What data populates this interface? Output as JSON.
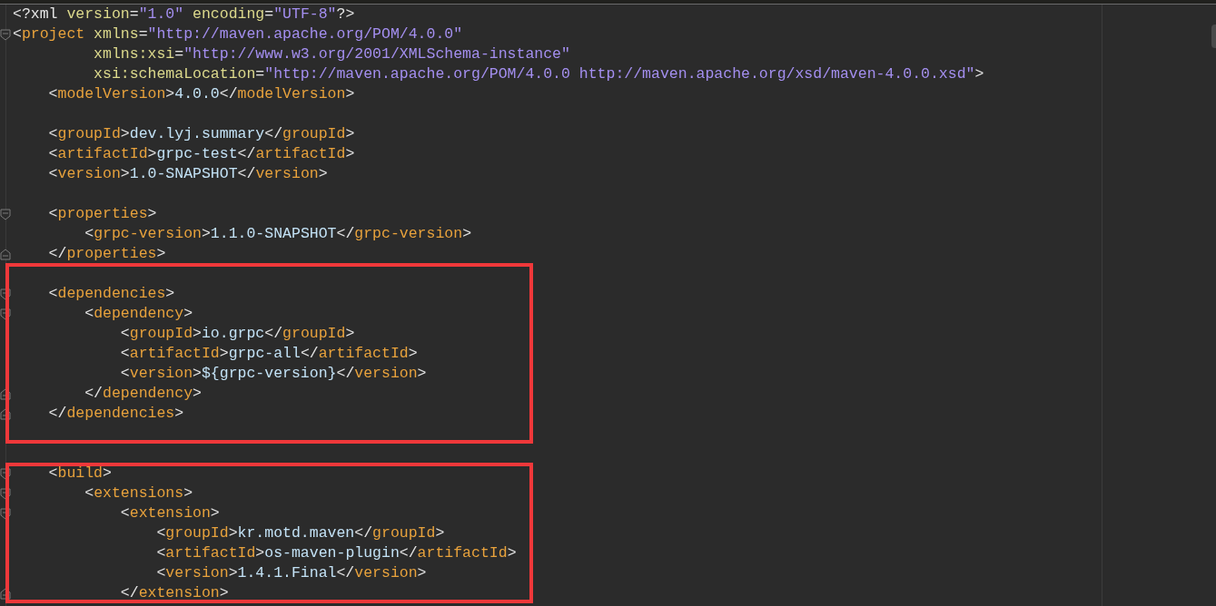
{
  "editor": {
    "blocks": [
      {
        "highlighted": false,
        "lines": [
          {
            "kind": "code",
            "segments": [
              {
                "kind": "punct",
                "text": "<?xml"
              },
              {
                "kind": "attr",
                "text": " version"
              },
              {
                "kind": "punct",
                "text": "="
              },
              {
                "kind": "value",
                "text": "\"1.0\""
              },
              {
                "kind": "attr",
                "text": " encoding"
              },
              {
                "kind": "punct",
                "text": "="
              },
              {
                "kind": "value",
                "text": "\"UTF-8\""
              },
              {
                "kind": "punct",
                "text": "?>"
              }
            ]
          },
          {
            "kind": "fold-start",
            "segments": [
              {
                "kind": "punct",
                "text": "<"
              },
              {
                "kind": "tag",
                "text": "project"
              },
              {
                "kind": "attr",
                "text": " xmlns"
              },
              {
                "kind": "punct",
                "text": "="
              },
              {
                "kind": "value",
                "text": "\"http://maven.apache.org/POM/4.0.0\""
              }
            ]
          },
          {
            "kind": "code",
            "segments": [
              {
                "kind": "attr",
                "text": "         xmlns:xsi"
              },
              {
                "kind": "punct",
                "text": "="
              },
              {
                "kind": "value",
                "text": "\"http://www.w3.org/2001/XMLSchema-instance\""
              }
            ]
          },
          {
            "kind": "code",
            "segments": [
              {
                "kind": "attr",
                "text": "         xsi:schemaLocation"
              },
              {
                "kind": "punct",
                "text": "="
              },
              {
                "kind": "value",
                "text": "\"http://maven.apache.org/POM/4.0.0 http://maven.apache.org/xsd/maven-4.0.0.xsd\""
              },
              {
                "kind": "punct",
                "text": ">"
              }
            ]
          },
          {
            "kind": "code",
            "segments": [
              {
                "kind": "punct",
                "text": "    <"
              },
              {
                "kind": "tag",
                "text": "modelVersion"
              },
              {
                "kind": "punct",
                "text": ">"
              },
              {
                "kind": "text",
                "text": "4.0.0"
              },
              {
                "kind": "punct",
                "text": "</"
              },
              {
                "kind": "tag",
                "text": "modelVersion"
              },
              {
                "kind": "punct",
                "text": ">"
              }
            ]
          },
          {
            "kind": "blank"
          },
          {
            "kind": "code",
            "segments": [
              {
                "kind": "punct",
                "text": "    <"
              },
              {
                "kind": "tag",
                "text": "groupId"
              },
              {
                "kind": "punct",
                "text": ">"
              },
              {
                "kind": "text",
                "text": "dev.lyj.summary"
              },
              {
                "kind": "punct",
                "text": "</"
              },
              {
                "kind": "tag",
                "text": "groupId"
              },
              {
                "kind": "punct",
                "text": ">"
              }
            ]
          },
          {
            "kind": "code",
            "segments": [
              {
                "kind": "punct",
                "text": "    <"
              },
              {
                "kind": "tag",
                "text": "artifactId"
              },
              {
                "kind": "punct",
                "text": ">"
              },
              {
                "kind": "text",
                "text": "grpc-test"
              },
              {
                "kind": "punct",
                "text": "</"
              },
              {
                "kind": "tag",
                "text": "artifactId"
              },
              {
                "kind": "punct",
                "text": ">"
              }
            ]
          },
          {
            "kind": "code",
            "segments": [
              {
                "kind": "punct",
                "text": "    <"
              },
              {
                "kind": "tag",
                "text": "version"
              },
              {
                "kind": "punct",
                "text": ">"
              },
              {
                "kind": "text",
                "text": "1.0-SNAPSHOT"
              },
              {
                "kind": "punct",
                "text": "</"
              },
              {
                "kind": "tag",
                "text": "version"
              },
              {
                "kind": "punct",
                "text": ">"
              }
            ]
          },
          {
            "kind": "blank"
          },
          {
            "kind": "fold-start",
            "segments": [
              {
                "kind": "punct",
                "text": "    <"
              },
              {
                "kind": "tag",
                "text": "properties"
              },
              {
                "kind": "punct",
                "text": ">"
              }
            ]
          },
          {
            "kind": "code",
            "segments": [
              {
                "kind": "punct",
                "text": "        <"
              },
              {
                "kind": "tag",
                "text": "grpc-version"
              },
              {
                "kind": "punct",
                "text": ">"
              },
              {
                "kind": "text",
                "text": "1.1.0-SNAPSHOT"
              },
              {
                "kind": "punct",
                "text": "</"
              },
              {
                "kind": "tag",
                "text": "grpc-version"
              },
              {
                "kind": "punct",
                "text": ">"
              }
            ]
          },
          {
            "kind": "fold-end",
            "segments": [
              {
                "kind": "punct",
                "text": "    </"
              },
              {
                "kind": "tag",
                "text": "properties"
              },
              {
                "kind": "punct",
                "text": ">"
              }
            ]
          }
        ]
      },
      {
        "highlighted": true,
        "lines": [
          {
            "kind": "blank"
          },
          {
            "kind": "fold-start",
            "segments": [
              {
                "kind": "punct",
                "text": "    <"
              },
              {
                "kind": "tag",
                "text": "dependencies"
              },
              {
                "kind": "punct",
                "text": ">"
              }
            ]
          },
          {
            "kind": "fold-start",
            "segments": [
              {
                "kind": "punct",
                "text": "        <"
              },
              {
                "kind": "tag",
                "text": "dependency"
              },
              {
                "kind": "punct",
                "text": ">"
              }
            ]
          },
          {
            "kind": "code",
            "segments": [
              {
                "kind": "punct",
                "text": "            <"
              },
              {
                "kind": "tag",
                "text": "groupId"
              },
              {
                "kind": "punct",
                "text": ">"
              },
              {
                "kind": "text",
                "text": "io.grpc"
              },
              {
                "kind": "punct",
                "text": "</"
              },
              {
                "kind": "tag",
                "text": "groupId"
              },
              {
                "kind": "punct",
                "text": ">"
              }
            ]
          },
          {
            "kind": "code",
            "segments": [
              {
                "kind": "punct",
                "text": "            <"
              },
              {
                "kind": "tag",
                "text": "artifactId"
              },
              {
                "kind": "punct",
                "text": ">"
              },
              {
                "kind": "text",
                "text": "grpc-all"
              },
              {
                "kind": "punct",
                "text": "</"
              },
              {
                "kind": "tag",
                "text": "artifactId"
              },
              {
                "kind": "punct",
                "text": ">"
              }
            ]
          },
          {
            "kind": "code",
            "segments": [
              {
                "kind": "punct",
                "text": "            <"
              },
              {
                "kind": "tag",
                "text": "version"
              },
              {
                "kind": "punct",
                "text": ">"
              },
              {
                "kind": "text",
                "text": "${grpc-version}"
              },
              {
                "kind": "punct",
                "text": "</"
              },
              {
                "kind": "tag",
                "text": "version"
              },
              {
                "kind": "punct",
                "text": ">"
              }
            ]
          },
          {
            "kind": "fold-end",
            "segments": [
              {
                "kind": "punct",
                "text": "        </"
              },
              {
                "kind": "tag",
                "text": "dependency"
              },
              {
                "kind": "punct",
                "text": ">"
              }
            ]
          },
          {
            "kind": "fold-end",
            "segments": [
              {
                "kind": "punct",
                "text": "    </"
              },
              {
                "kind": "tag",
                "text": "dependencies"
              },
              {
                "kind": "punct",
                "text": ">"
              }
            ]
          },
          {
            "kind": "blank"
          }
        ]
      },
      {
        "highlighted": false,
        "lines": [
          {
            "kind": "blank"
          }
        ]
      },
      {
        "highlighted": true,
        "lines": [
          {
            "kind": "fold-start",
            "segments": [
              {
                "kind": "punct",
                "text": "    <"
              },
              {
                "kind": "tag",
                "text": "build"
              },
              {
                "kind": "punct",
                "text": ">"
              }
            ]
          },
          {
            "kind": "fold-start",
            "segments": [
              {
                "kind": "punct",
                "text": "        <"
              },
              {
                "kind": "tag",
                "text": "extensions"
              },
              {
                "kind": "punct",
                "text": ">"
              }
            ]
          },
          {
            "kind": "fold-start",
            "segments": [
              {
                "kind": "punct",
                "text": "            <"
              },
              {
                "kind": "tag",
                "text": "extension"
              },
              {
                "kind": "punct",
                "text": ">"
              }
            ]
          },
          {
            "kind": "code",
            "segments": [
              {
                "kind": "punct",
                "text": "                <"
              },
              {
                "kind": "tag",
                "text": "groupId"
              },
              {
                "kind": "punct",
                "text": ">"
              },
              {
                "kind": "text",
                "text": "kr.motd.maven"
              },
              {
                "kind": "punct",
                "text": "</"
              },
              {
                "kind": "tag",
                "text": "groupId"
              },
              {
                "kind": "punct",
                "text": ">"
              }
            ]
          },
          {
            "kind": "code",
            "segments": [
              {
                "kind": "punct",
                "text": "                <"
              },
              {
                "kind": "tag",
                "text": "artifactId"
              },
              {
                "kind": "punct",
                "text": ">"
              },
              {
                "kind": "text",
                "text": "os-maven-plugin"
              },
              {
                "kind": "punct",
                "text": "</"
              },
              {
                "kind": "tag",
                "text": "artifactId"
              },
              {
                "kind": "punct",
                "text": ">"
              }
            ]
          },
          {
            "kind": "code",
            "segments": [
              {
                "kind": "punct",
                "text": "                <"
              },
              {
                "kind": "tag",
                "text": "version"
              },
              {
                "kind": "punct",
                "text": ">"
              },
              {
                "kind": "text",
                "text": "1.4.1.Final"
              },
              {
                "kind": "punct",
                "text": "</"
              },
              {
                "kind": "tag",
                "text": "version"
              },
              {
                "kind": "punct",
                "text": ">"
              }
            ]
          },
          {
            "kind": "fold-end",
            "segments": [
              {
                "kind": "punct",
                "text": "            </"
              },
              {
                "kind": "tag",
                "text": "extension"
              },
              {
                "kind": "punct",
                "text": ">"
              }
            ]
          }
        ]
      }
    ]
  }
}
